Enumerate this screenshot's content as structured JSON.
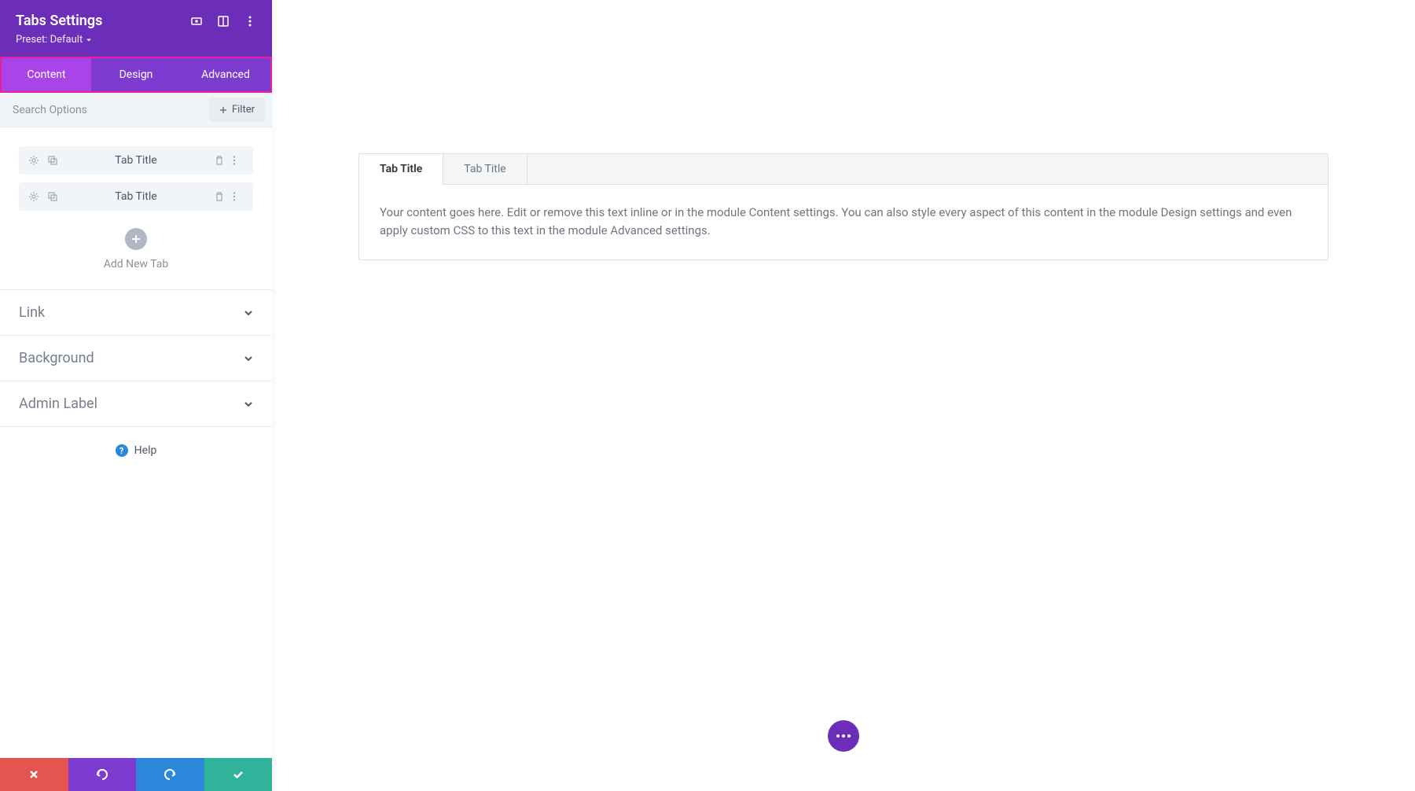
{
  "header": {
    "title": "Tabs Settings",
    "preset_label": "Preset: Default"
  },
  "nav_tabs": {
    "content": "Content",
    "design": "Design",
    "advanced": "Advanced"
  },
  "search": {
    "placeholder": "Search Options",
    "filter_label": "Filter"
  },
  "tab_items": [
    {
      "title": "Tab Title"
    },
    {
      "title": "Tab Title"
    }
  ],
  "add_new_label": "Add New Tab",
  "accordion": {
    "link": "Link",
    "background": "Background",
    "admin_label": "Admin Label"
  },
  "help_label": "Help",
  "preview": {
    "tabs": [
      {
        "label": "Tab Title",
        "active": true
      },
      {
        "label": "Tab Title",
        "active": false
      }
    ],
    "body": "Your content goes here. Edit or remove this text inline or in the module Content settings. You can also style every aspect of this content in the module Design settings and even apply custom CSS to this text in the module Advanced settings."
  }
}
